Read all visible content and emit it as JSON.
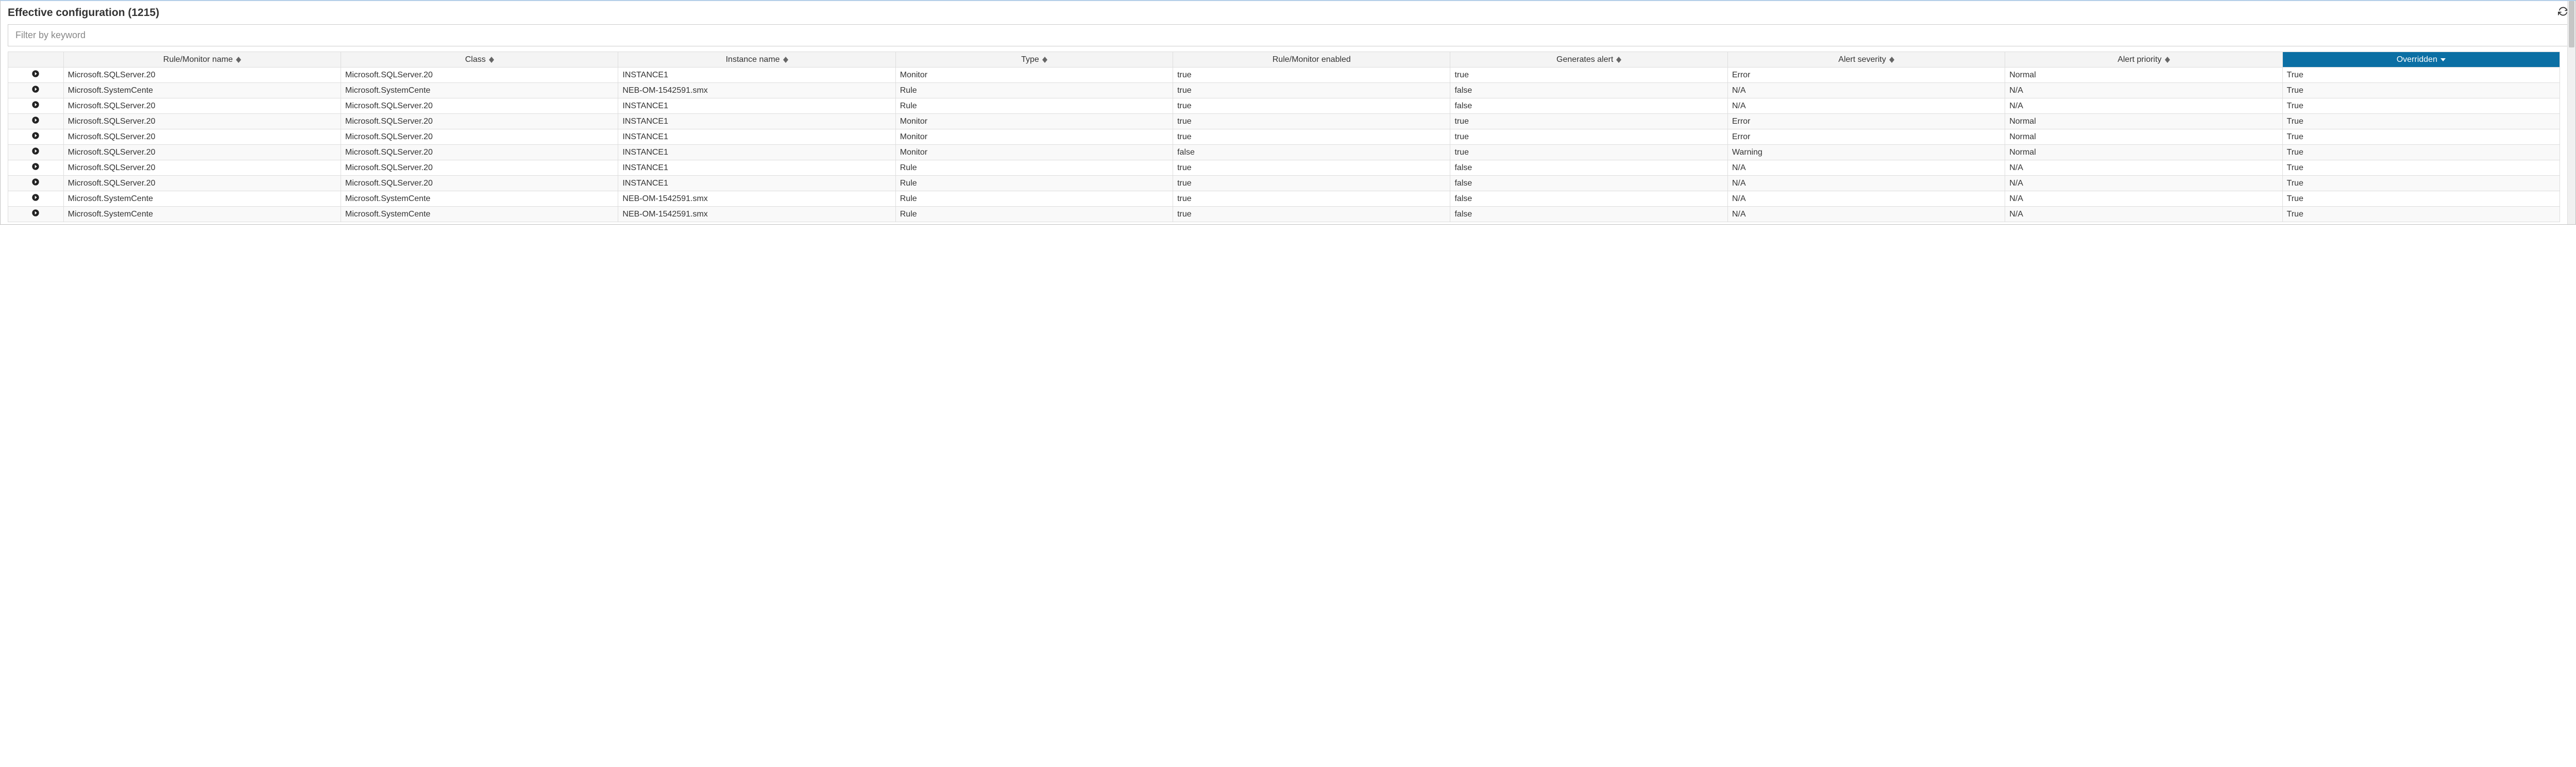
{
  "header": {
    "title": "Effective configuration (1215)"
  },
  "filter": {
    "placeholder": "Filter by keyword"
  },
  "columns": [
    {
      "label": "",
      "sortable": false
    },
    {
      "label": "Rule/Monitor name",
      "sortable": true
    },
    {
      "label": "Class",
      "sortable": true
    },
    {
      "label": "Instance name",
      "sortable": true
    },
    {
      "label": "Type",
      "sortable": true
    },
    {
      "label": "Rule/Monitor enabled",
      "sortable": false
    },
    {
      "label": "Generates alert",
      "sortable": true
    },
    {
      "label": "Alert severity",
      "sortable": true
    },
    {
      "label": "Alert priority",
      "sortable": true
    },
    {
      "label": "Overridden",
      "sortable": true,
      "sorted": "desc"
    }
  ],
  "rows": [
    {
      "name": "Microsoft.SQLServer.20",
      "class": "Microsoft.SQLServer.20",
      "instance": "INSTANCE1",
      "type": "Monitor",
      "enabled": "true",
      "generates": "true",
      "severity": "Error",
      "priority": "Normal",
      "overridden": "True"
    },
    {
      "name": "Microsoft.SystemCente",
      "class": "Microsoft.SystemCente",
      "instance": "NEB-OM-1542591.smx",
      "type": "Rule",
      "enabled": "true",
      "generates": "false",
      "severity": "N/A",
      "priority": "N/A",
      "overridden": "True"
    },
    {
      "name": "Microsoft.SQLServer.20",
      "class": "Microsoft.SQLServer.20",
      "instance": "INSTANCE1",
      "type": "Rule",
      "enabled": "true",
      "generates": "false",
      "severity": "N/A",
      "priority": "N/A",
      "overridden": "True"
    },
    {
      "name": "Microsoft.SQLServer.20",
      "class": "Microsoft.SQLServer.20",
      "instance": "INSTANCE1",
      "type": "Monitor",
      "enabled": "true",
      "generates": "true",
      "severity": "Error",
      "priority": "Normal",
      "overridden": "True"
    },
    {
      "name": "Microsoft.SQLServer.20",
      "class": "Microsoft.SQLServer.20",
      "instance": "INSTANCE1",
      "type": "Monitor",
      "enabled": "true",
      "generates": "true",
      "severity": "Error",
      "priority": "Normal",
      "overridden": "True"
    },
    {
      "name": "Microsoft.SQLServer.20",
      "class": "Microsoft.SQLServer.20",
      "instance": "INSTANCE1",
      "type": "Monitor",
      "enabled": "false",
      "generates": "true",
      "severity": "Warning",
      "priority": "Normal",
      "overridden": "True"
    },
    {
      "name": "Microsoft.SQLServer.20",
      "class": "Microsoft.SQLServer.20",
      "instance": "INSTANCE1",
      "type": "Rule",
      "enabled": "true",
      "generates": "false",
      "severity": "N/A",
      "priority": "N/A",
      "overridden": "True"
    },
    {
      "name": "Microsoft.SQLServer.20",
      "class": "Microsoft.SQLServer.20",
      "instance": "INSTANCE1",
      "type": "Rule",
      "enabled": "true",
      "generates": "false",
      "severity": "N/A",
      "priority": "N/A",
      "overridden": "True"
    },
    {
      "name": "Microsoft.SystemCente",
      "class": "Microsoft.SystemCente",
      "instance": "NEB-OM-1542591.smx",
      "type": "Rule",
      "enabled": "true",
      "generates": "false",
      "severity": "N/A",
      "priority": "N/A",
      "overridden": "True"
    },
    {
      "name": "Microsoft.SystemCente",
      "class": "Microsoft.SystemCente",
      "instance": "NEB-OM-1542591.smx",
      "type": "Rule",
      "enabled": "true",
      "generates": "false",
      "severity": "N/A",
      "priority": "N/A",
      "overridden": "True"
    }
  ]
}
